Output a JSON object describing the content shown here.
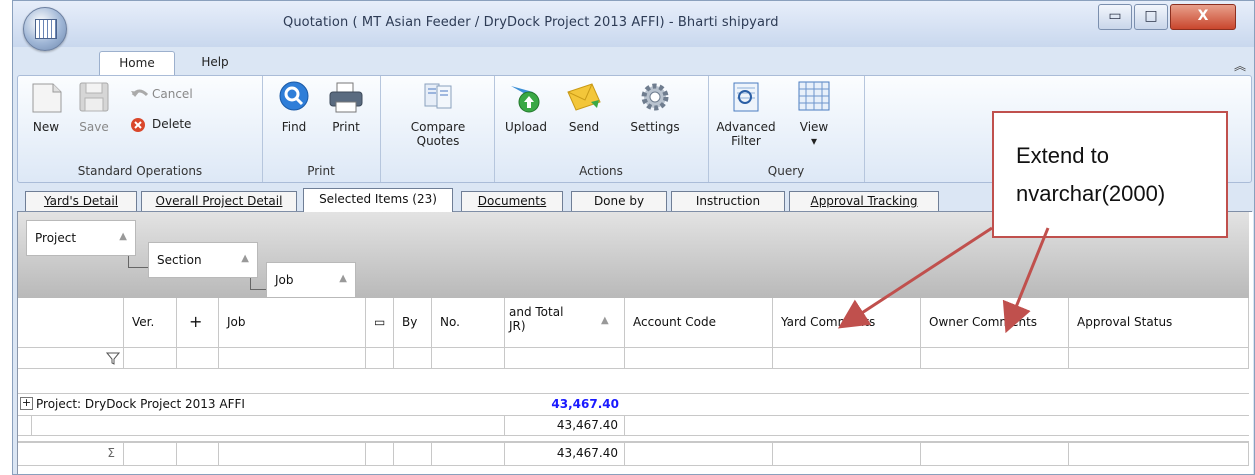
{
  "window": {
    "title": "Quotation ( MT Asian Feeder / DryDock Project 2013 AFFI) - Bharti shipyard",
    "controls": {
      "min": "▭",
      "max": "□",
      "close": "X"
    }
  },
  "ribbon_tabs": [
    {
      "label": "Home",
      "active": true
    },
    {
      "label": "Help",
      "active": false
    }
  ],
  "ribbon": {
    "standard": {
      "new": "New",
      "save": "Save",
      "cancel": "Cancel",
      "delete": "Delete",
      "label": "Standard Operations"
    },
    "print": {
      "find": "Find",
      "print": "Print",
      "label": "Print"
    },
    "compare": {
      "line1": "Compare",
      "line2": "Quotes"
    },
    "actions": {
      "upload": "Upload",
      "send": "Send",
      "settings": "Settings",
      "label": "Actions"
    },
    "query": {
      "advanced_line1": "Advanced",
      "advanced_line2": "Filter",
      "view": "View",
      "view_arrow": "▾",
      "label": "Query"
    }
  },
  "doc_tabs": [
    {
      "label": "Yard's Detail"
    },
    {
      "label": "Overall Project Detail"
    },
    {
      "label": "Selected Items (23)",
      "active": true
    },
    {
      "label": "Documents"
    },
    {
      "label": "Done by"
    },
    {
      "label": "Instruction"
    },
    {
      "label": "Approval Tracking"
    }
  ],
  "grouping": {
    "level1": "Project",
    "level2": "Section",
    "level3": "Job",
    "arrow": "▲"
  },
  "columns": {
    "ver": "Ver.",
    "plus": "+",
    "job": "Job",
    "by": "By",
    "no": "No.",
    "grand_total_line1": "and Total",
    "grand_total_line2": "JR)",
    "sort_arrow": "▲",
    "account_code": "Account Code",
    "yard_comments": "Yard Comments",
    "owner_comments": "Owner Comments",
    "approval_status": "Approval Status"
  },
  "rows": {
    "group_expand": "+",
    "group_label": "Project:  DryDock Project 2013 AFFI",
    "group_total": "43,467.40",
    "subtotal": "43,467.40",
    "sum_symbol": "Σ",
    "sum_total": "43,467.40"
  },
  "annotation": {
    "line1": "Extend to",
    "line2": "nvarchar(2000)",
    "color": "#c0504d"
  }
}
